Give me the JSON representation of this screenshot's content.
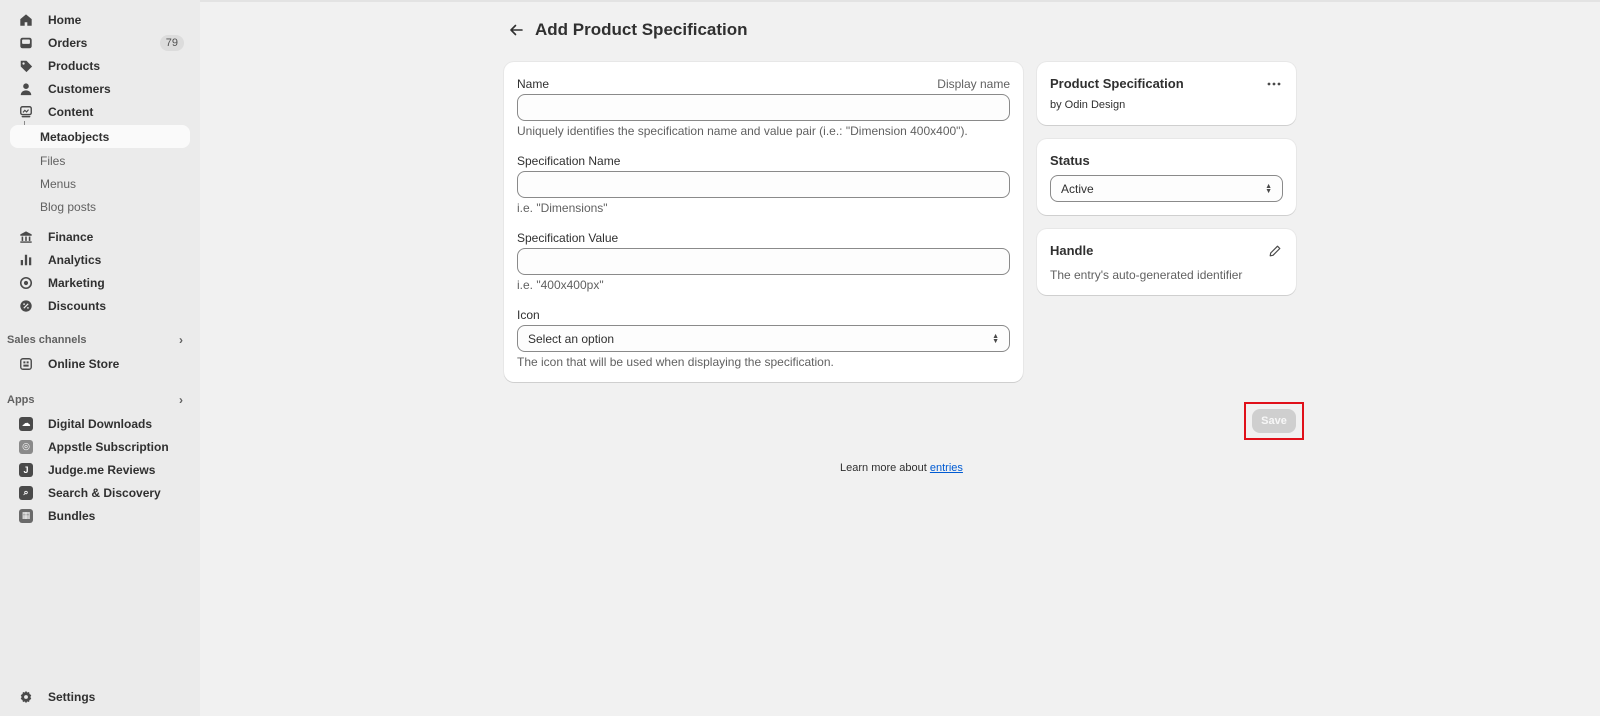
{
  "sidebar": {
    "main_items": [
      {
        "label": "Home",
        "icon": "home-icon"
      },
      {
        "label": "Orders",
        "icon": "inbox-icon",
        "badge": "79"
      },
      {
        "label": "Products",
        "icon": "tag-icon"
      },
      {
        "label": "Customers",
        "icon": "person-icon"
      },
      {
        "label": "Content",
        "icon": "content-icon"
      }
    ],
    "content_sub": [
      "Metaobjects",
      "Files",
      "Menus",
      "Blog posts"
    ],
    "secondary_items": [
      {
        "label": "Finance",
        "icon": "bank-icon"
      },
      {
        "label": "Analytics",
        "icon": "bar-chart-icon"
      },
      {
        "label": "Marketing",
        "icon": "target-icon"
      },
      {
        "label": "Discounts",
        "icon": "discount-icon"
      }
    ],
    "sales_channels": {
      "heading": "Sales channels",
      "items": [
        "Online Store"
      ]
    },
    "apps": {
      "heading": "Apps",
      "items": [
        "Digital Downloads",
        "Appstle Subscription",
        "Judge.me Reviews",
        "Search & Discovery",
        "Bundles"
      ]
    },
    "settings": "Settings"
  },
  "page": {
    "title": "Add Product Specification"
  },
  "form": {
    "name": {
      "label": "Name",
      "aside": "Display name",
      "value": "",
      "help": "Uniquely identifies the specification name and value pair (i.e.: \"Dimension 400x400\")."
    },
    "spec_name": {
      "label": "Specification Name",
      "value": "",
      "help": "i.e. \"Dimensions\""
    },
    "spec_value": {
      "label": "Specification Value",
      "value": "",
      "help": "i.e. \"400x400px\""
    },
    "icon": {
      "label": "Icon",
      "selected": "Select an option",
      "help": "The icon that will be used when displaying the specification."
    }
  },
  "definition_card": {
    "title": "Product Specification",
    "subtitle": "by Odin Design"
  },
  "status_card": {
    "title": "Status",
    "selected": "Active"
  },
  "handle_card": {
    "title": "Handle",
    "description": "The entry's auto-generated identifier"
  },
  "actions": {
    "save": "Save"
  },
  "footer": {
    "text": "Learn more about ",
    "link": "entries"
  },
  "colors": {
    "accent_link": "#005bd3",
    "highlight": "#e0101a",
    "disabled_button": "#cfcfcf"
  }
}
